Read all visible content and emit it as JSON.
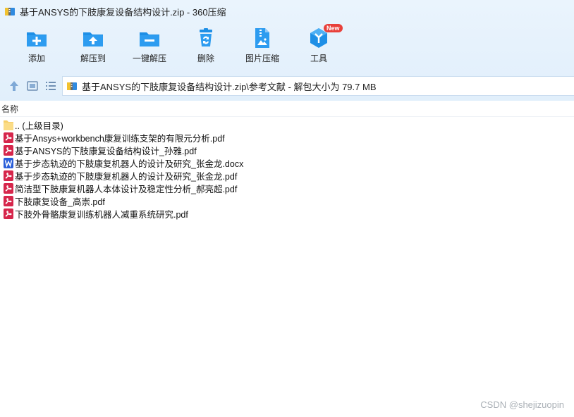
{
  "window": {
    "title": "基于ANSYS的下肢康复设备结构设计.zip - 360压缩"
  },
  "toolbar": {
    "items": [
      {
        "label": "添加",
        "icon": "add-icon"
      },
      {
        "label": "解压到",
        "icon": "extract-to-icon"
      },
      {
        "label": "一键解压",
        "icon": "one-click-extract-icon"
      },
      {
        "label": "删除",
        "icon": "delete-icon"
      },
      {
        "label": "图片压缩",
        "icon": "image-compress-icon"
      },
      {
        "label": "工具",
        "icon": "tools-icon",
        "badge": "New"
      }
    ]
  },
  "navigation": {
    "address": "基于ANSYS的下肢康复设备结构设计.zip\\参考文献 - 解包大小为 79.7 MB"
  },
  "list": {
    "column_name": "名称",
    "files": [
      {
        "name": ".. (上级目录)",
        "type": "folder"
      },
      {
        "name": "基于Ansys+workbench康复训练支架的有限元分析.pdf",
        "type": "pdf"
      },
      {
        "name": "基于ANSYS的下肢康复设备结构设计_孙雅.pdf",
        "type": "pdf"
      },
      {
        "name": "基于步态轨迹的下肢康复机器人的设计及研究_张金龙.docx",
        "type": "docx"
      },
      {
        "name": "基于步态轨迹的下肢康复机器人的设计及研究_张金龙.pdf",
        "type": "pdf"
      },
      {
        "name": "简洁型下肢康复机器人本体设计及稳定性分析_郝亮超.pdf",
        "type": "pdf"
      },
      {
        "name": "下肢康复设备_高崇.pdf",
        "type": "pdf"
      },
      {
        "name": "下肢外骨骼康复训练机器人减重系统研究.pdf",
        "type": "pdf"
      }
    ]
  },
  "watermark": "CSDN @shejizuopin",
  "colors": {
    "accent_blue": "#1e8fe6",
    "pdf_red": "#d6264b",
    "docx_blue": "#2b5fd9",
    "folder_yellow": "#f6cf6a"
  }
}
